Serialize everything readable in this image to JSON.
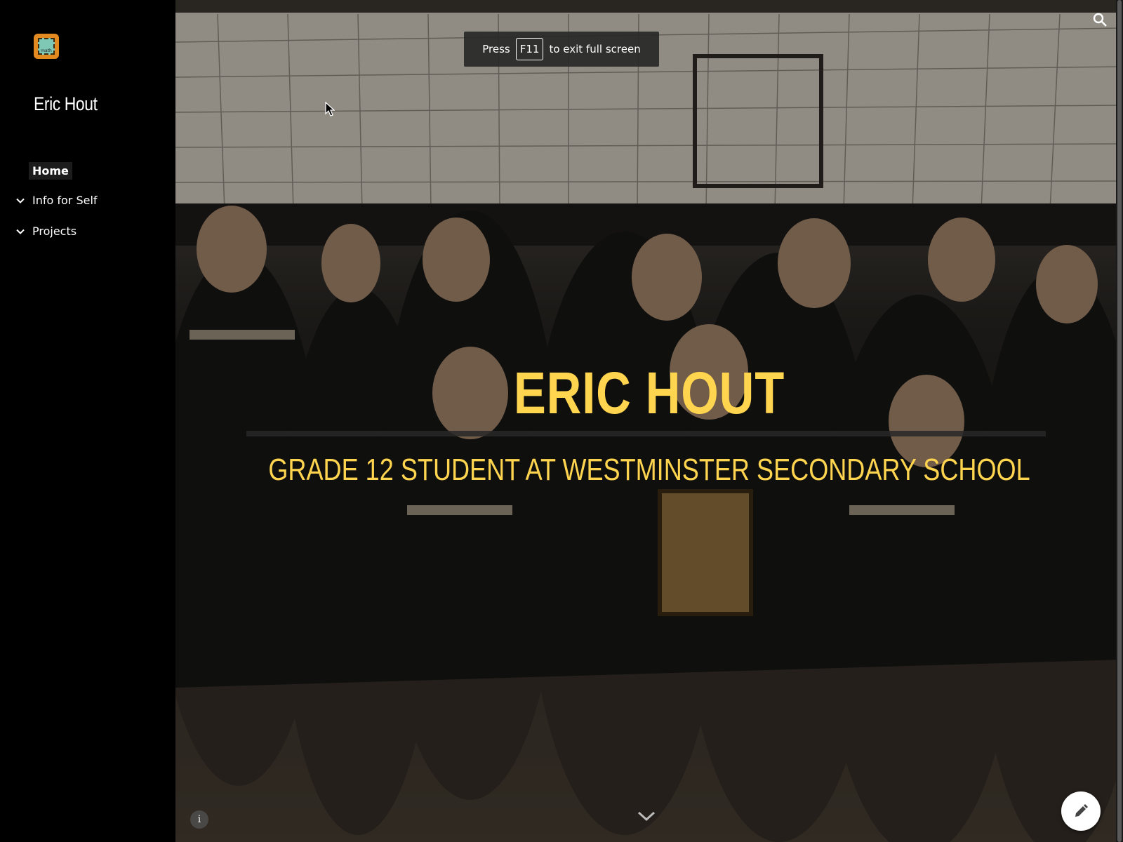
{
  "sidebar": {
    "logo_label": "math",
    "site_title": "Eric Hout",
    "nav": [
      {
        "label": "Home",
        "selected": true,
        "expandable": false
      },
      {
        "label": "Info for Self",
        "selected": false,
        "expandable": true
      },
      {
        "label": "Projects",
        "selected": false,
        "expandable": true
      }
    ]
  },
  "hero": {
    "title": "ERIC HOUT",
    "subtitle": "GRADE 12 STUDENT AT WESTMINSTER SECONDARY SCHOOL",
    "accent_color": "#ffd44f"
  },
  "fullscreen_toast": {
    "prefix": "Press",
    "key": "F11",
    "suffix": "to exit full screen"
  },
  "icons": {
    "search": "search-icon",
    "info": "info-icon",
    "scroll_down": "chevron-down-icon",
    "edit": "pencil-icon"
  }
}
